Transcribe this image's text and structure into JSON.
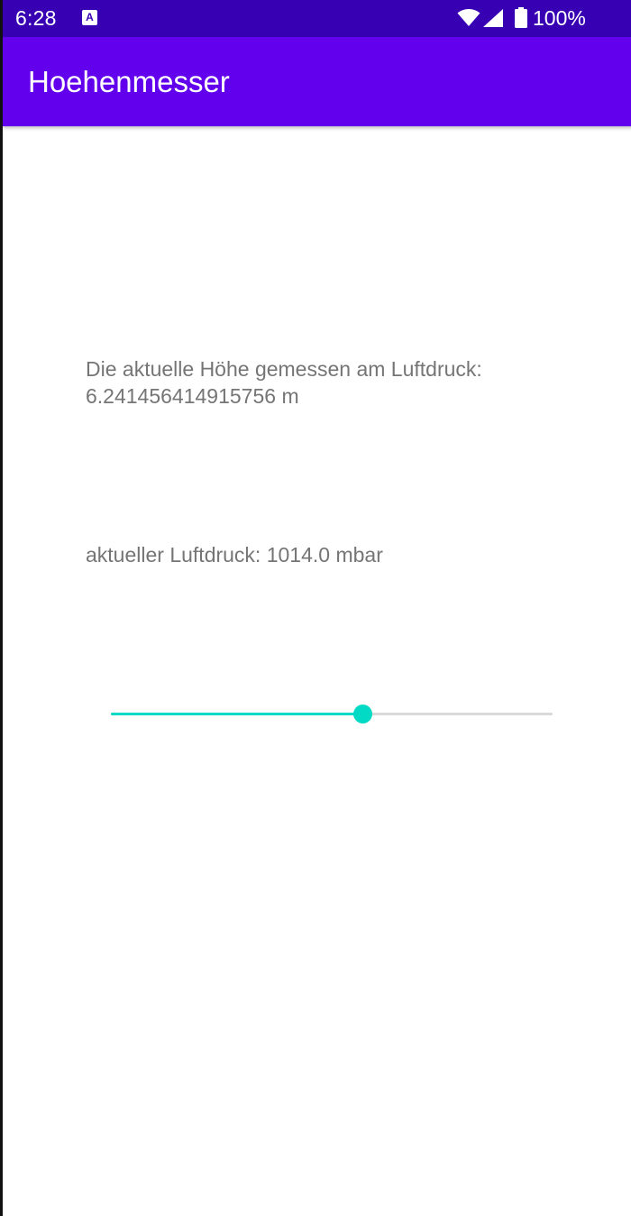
{
  "status_bar": {
    "time": "6:28",
    "notification_icon": "accessibility-a-icon",
    "wifi_icon": "wifi-icon",
    "signal_icon": "cell-signal-icon",
    "battery_icon": "battery-icon",
    "battery_level": "100%"
  },
  "app_bar": {
    "title": "Hoehenmesser"
  },
  "main": {
    "altitude_text": "Die aktuelle Höhe gemessen am Luftdruck: 6.241456414915756 m",
    "pressure_text": "aktueller Luftdruck: 1014.0 mbar",
    "slider": {
      "value_fraction": 0.57
    }
  },
  "colors": {
    "status_bar": "#3700b3",
    "app_bar": "#6200ee",
    "accent": "#03dac5",
    "body_text": "#757575"
  }
}
